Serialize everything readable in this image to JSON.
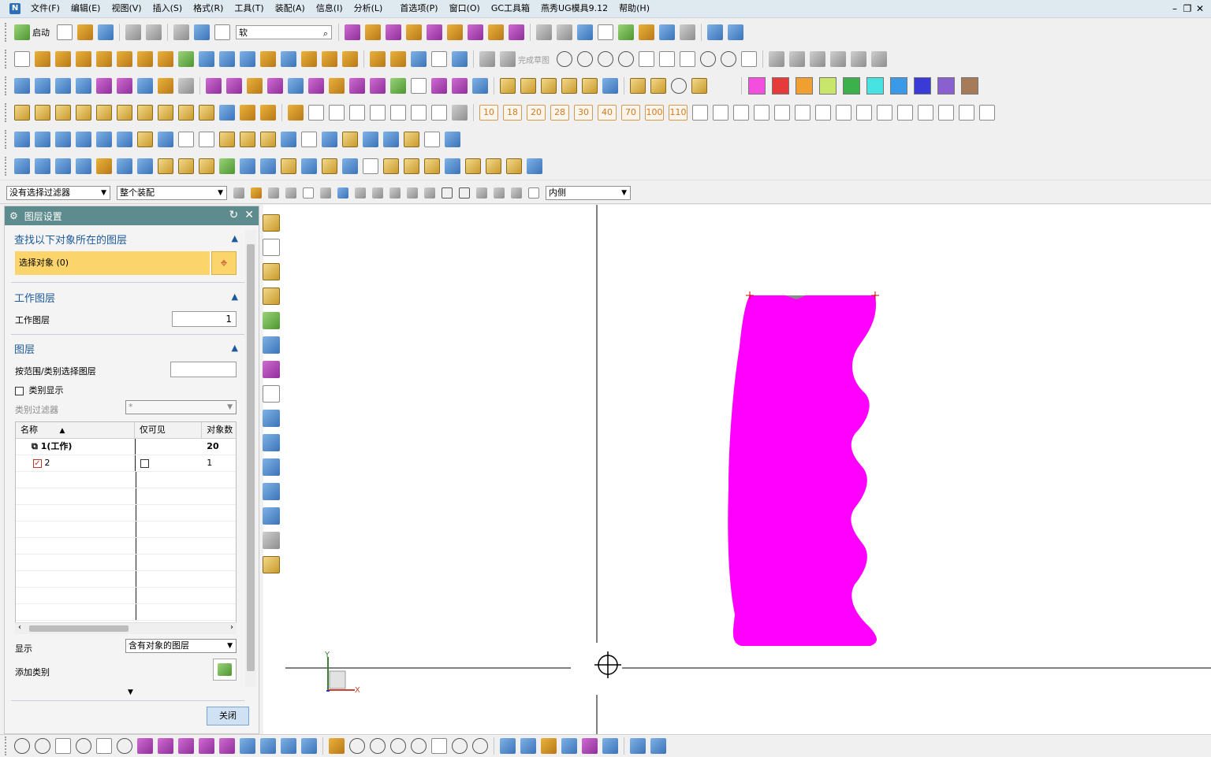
{
  "menu": {
    "items": [
      "文件(F)",
      "编辑(E)",
      "视图(V)",
      "插入(S)",
      "格式(R)",
      "工具(T)",
      "装配(A)",
      "信息(I)",
      "分析(L)",
      "首选项(P)",
      "窗口(O)",
      "GC工具箱",
      "燕秀UG模具9.12",
      "帮助(H)"
    ]
  },
  "toolbar": {
    "start_label": "启动",
    "search_value": "软",
    "finish_sketch": "完成草图",
    "number_buttons": [
      "10",
      "18",
      "20",
      "28",
      "30",
      "40",
      "70",
      "100",
      "110"
    ],
    "swatches": [
      "#f24fe0",
      "#e63b3b",
      "#f0a030",
      "#c8e66a",
      "#3cb04a",
      "#47e3e3",
      "#3a9ae8",
      "#3a3ad6",
      "#8a5fd0",
      "#a57b5a"
    ]
  },
  "filter": {
    "selection_filter": "没有选择过滤器",
    "assembly_scope": "整个装配",
    "side": "内侧"
  },
  "panel": {
    "title": "图层设置",
    "section1": "查找以下对象所在的图层",
    "select_objects": "选择对象 (0)",
    "section2": "工作图层",
    "work_layer_label": "工作图层",
    "work_layer_value": "1",
    "section3": "图层",
    "range_label": "按范围/类别选择图层",
    "category_display": "类别显示",
    "category_filter_label": "类别过滤器",
    "category_filter_value": "*",
    "columns": [
      "名称",
      "仅可见",
      "对象数"
    ],
    "rows": [
      {
        "name": "1(工作)",
        "visible_only": "",
        "count": "20"
      },
      {
        "name": "2",
        "visible_only": "",
        "count": "1"
      }
    ],
    "display_label": "显示",
    "display_value": "含有对象的图层",
    "add_category": "添加类别",
    "close_button": "关闭"
  },
  "canvas": {
    "part_color": "#ff00ff",
    "axis_x": "X",
    "axis_y": "Y"
  }
}
